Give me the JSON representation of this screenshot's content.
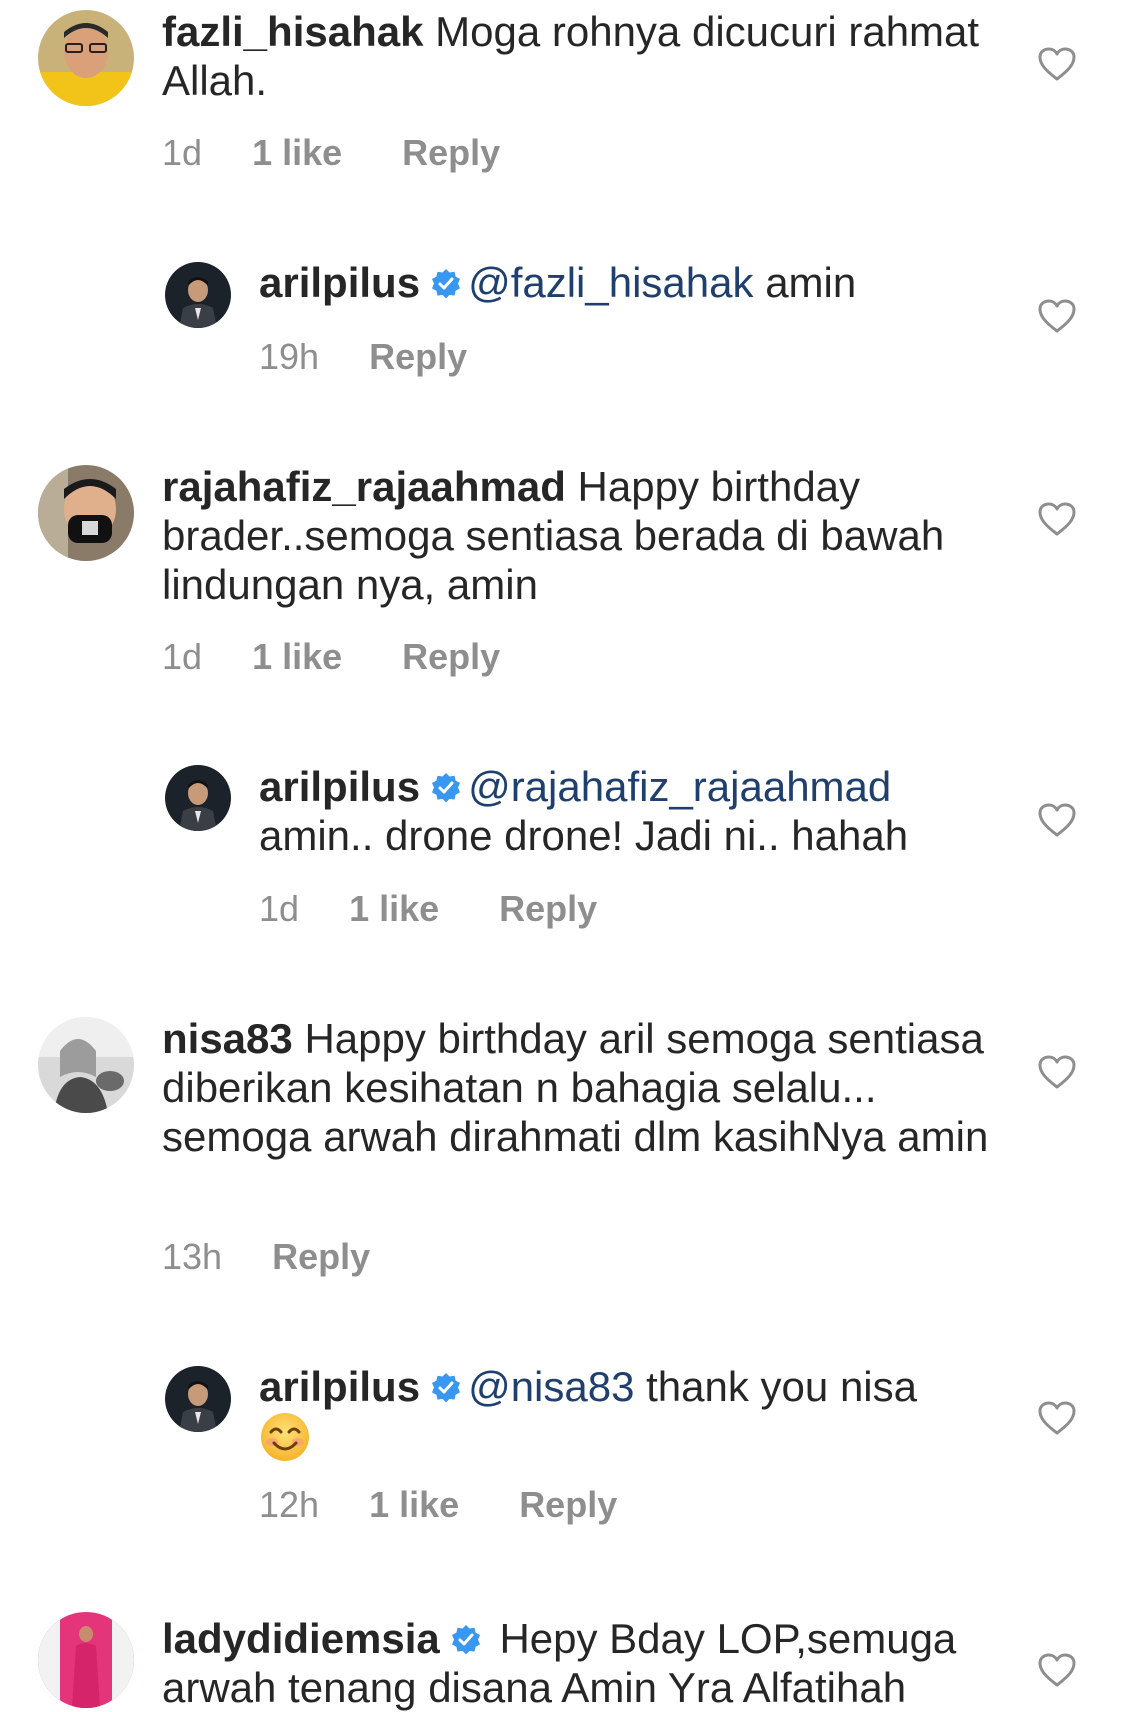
{
  "comments": [
    {
      "username": "fazli_hisahak",
      "text": "Moga rohnya dicucuri rahmat Allah.",
      "time": "1d",
      "likes": "1 like",
      "reply": "Reply"
    },
    {
      "username": "arilpilus",
      "mention": "@fazli_hisahak",
      "text": "amin",
      "time": "19h",
      "reply": "Reply"
    },
    {
      "username": "rajahafiz_rajaahmad",
      "text": "Happy birthday brader..semoga sentiasa berada di bawah lindungan nya, amin",
      "time": "1d",
      "likes": "1 like",
      "reply": "Reply"
    },
    {
      "username": "arilpilus",
      "mention": "@rajahafiz_rajaahmad",
      "text": "amin.. drone drone! Jadi ni.. hahah",
      "time": "1d",
      "likes": "1 like",
      "reply": "Reply"
    },
    {
      "username": "nisa83",
      "text": "Happy birthday aril semoga sentiasa diberikan kesihatan n bahagia selalu... semoga arwah dirahmati dlm kasihNya amin",
      "time": "13h",
      "reply": "Reply"
    },
    {
      "username": "arilpilus",
      "mention": "@nisa83",
      "text": "thank you nisa",
      "emoji": "smiling-face-emoji",
      "time": "12h",
      "likes": "1 like",
      "reply": "Reply"
    },
    {
      "username": "ladydidiemsia",
      "text": "Hepy Bday LOP,semuga arwah tenang disana Amin Yra Alfatihah"
    }
  ],
  "icons": {
    "heart": "heart-outline-icon",
    "verified": "verified-badge-icon"
  },
  "colors": {
    "text": "#262626",
    "meta": "#8e8e8e",
    "mention": "#1f3f6e",
    "verified": "#3897f0"
  }
}
